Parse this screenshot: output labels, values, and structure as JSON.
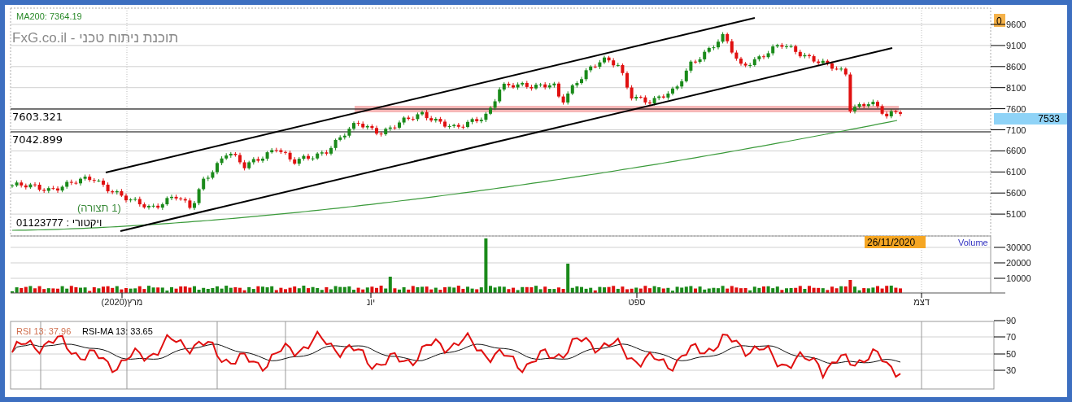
{
  "price_panel": {
    "ma_label": "MA200: 7364.19",
    "watermark": "FxG.co.il - תוכנת ניתוח טכני",
    "corner_badge": "0",
    "last_price": "7533",
    "levels": [
      {
        "label": "7603.321"
      },
      {
        "label": "7042.899"
      }
    ],
    "pattern_label": "(1 תצורה)",
    "account_label": "01123777 : ויקטורי",
    "yticks": [
      "9600",
      "9100",
      "8600",
      "8100",
      "7600",
      "7100",
      "6600",
      "6100",
      "5600",
      "5100"
    ]
  },
  "volume_panel": {
    "date_badge": "26/11/2020",
    "title": "Volume",
    "yticks": [
      "30000",
      "20000",
      "10000"
    ]
  },
  "time_axis": [
    "דצמ",
    "ספט",
    "יונ",
    "מרץ(2020)"
  ],
  "rsi_panel": {
    "rsi_label": "RSI 13: 37.96",
    "ma_label": "RSI-MA 13: 33.65",
    "yticks": [
      "90",
      "70",
      "50",
      "30"
    ]
  }
}
